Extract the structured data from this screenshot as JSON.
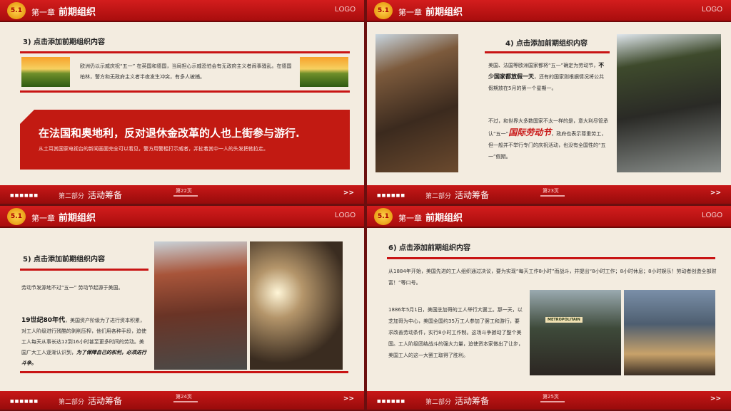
{
  "common": {
    "badge": "5.1",
    "chapter": "第一章",
    "title": "前期组织",
    "logo": "LOGO",
    "dots": "■■■■■■",
    "part": "第二部分",
    "part_name": "活动筹备",
    "next": ">>"
  },
  "s1": {
    "page": "第22页",
    "heading": "3) 点击添加前期组织内容",
    "para": "欧洲仍以示威庆祝“五一” 在英国和德国，当局担心示威恐怕会有无政府主义者闹事骚乱。在德国柏林，警方和无政府主义者半夜发生冲突，有多人被捕。",
    "big_title": "在法国和奥地利，反对退休金改革的人也上街参与游行.",
    "big_sub": "从土耳其国家电视台的新闻画面完全可以看见，警方用警棍打示威者，并扯着其中一人的头发把他拉走。"
  },
  "s2": {
    "page": "第23页",
    "heading": "4) 点击添加前期组织内容",
    "p1a": "美国、法国等欧洲国家都将“五一”确定为劳动节，",
    "p1b": "不少国家都放假一天",
    "p1c": "，还有的国家则根据情况将公共假期放在5月的第一个星期一。",
    "p2a": "不过，和世界大多数国家不太一样的是，意大利尽管承认“五一”",
    "p2b": "国际劳动节",
    "p2c": "，政府也表示尊重劳工，但一般并不举行专门的庆祝活动，也没有全国性的“五一”假期。"
  },
  "s3": {
    "page": "第24页",
    "heading": "5) 点击添加前期组织内容",
    "p1": "劳动节发源地不过“五一” 劳动节起源于美国。",
    "p2a": "19世纪80年代",
    "p2b": "，美国资产阶级为了进行资本积累，对工人阶级进行残酷的剥削压榨，他们用各种手段，迫使工人每天从事长达12到16小时甚至更多时间的劳动。美国广大工人逐渐认识到，",
    "p2c": "为了保障自己的权利，必须进行斗争。"
  },
  "s4": {
    "page": "第25页",
    "heading": "6) 点击添加前期组织内容",
    "p1": "从1884年开始，美国先进的工人组织通过决议，要为实现“每天工作8小时”而战斗，并提出“8小时工作；8小时休息；8小时娱乐！劳动者创造全部财富！”等口号。",
    "p2": "1886年5月1日，美国芝加哥的工人举行大罢工。那一天，以芝加哥为中心，美国全国约35万工人参加了罢工和游行，要求改善劳动条件，实行8小时工作制。这场斗争撼动了整个美国。工人阶级团结战斗的强大力量，迫使资本家做出了让步，美国工人的这一大罢工取得了胜利。",
    "sign": "METROPOLITAIN"
  },
  "colors": {
    "primary": "#c81414",
    "paper": "#f3ece0"
  }
}
